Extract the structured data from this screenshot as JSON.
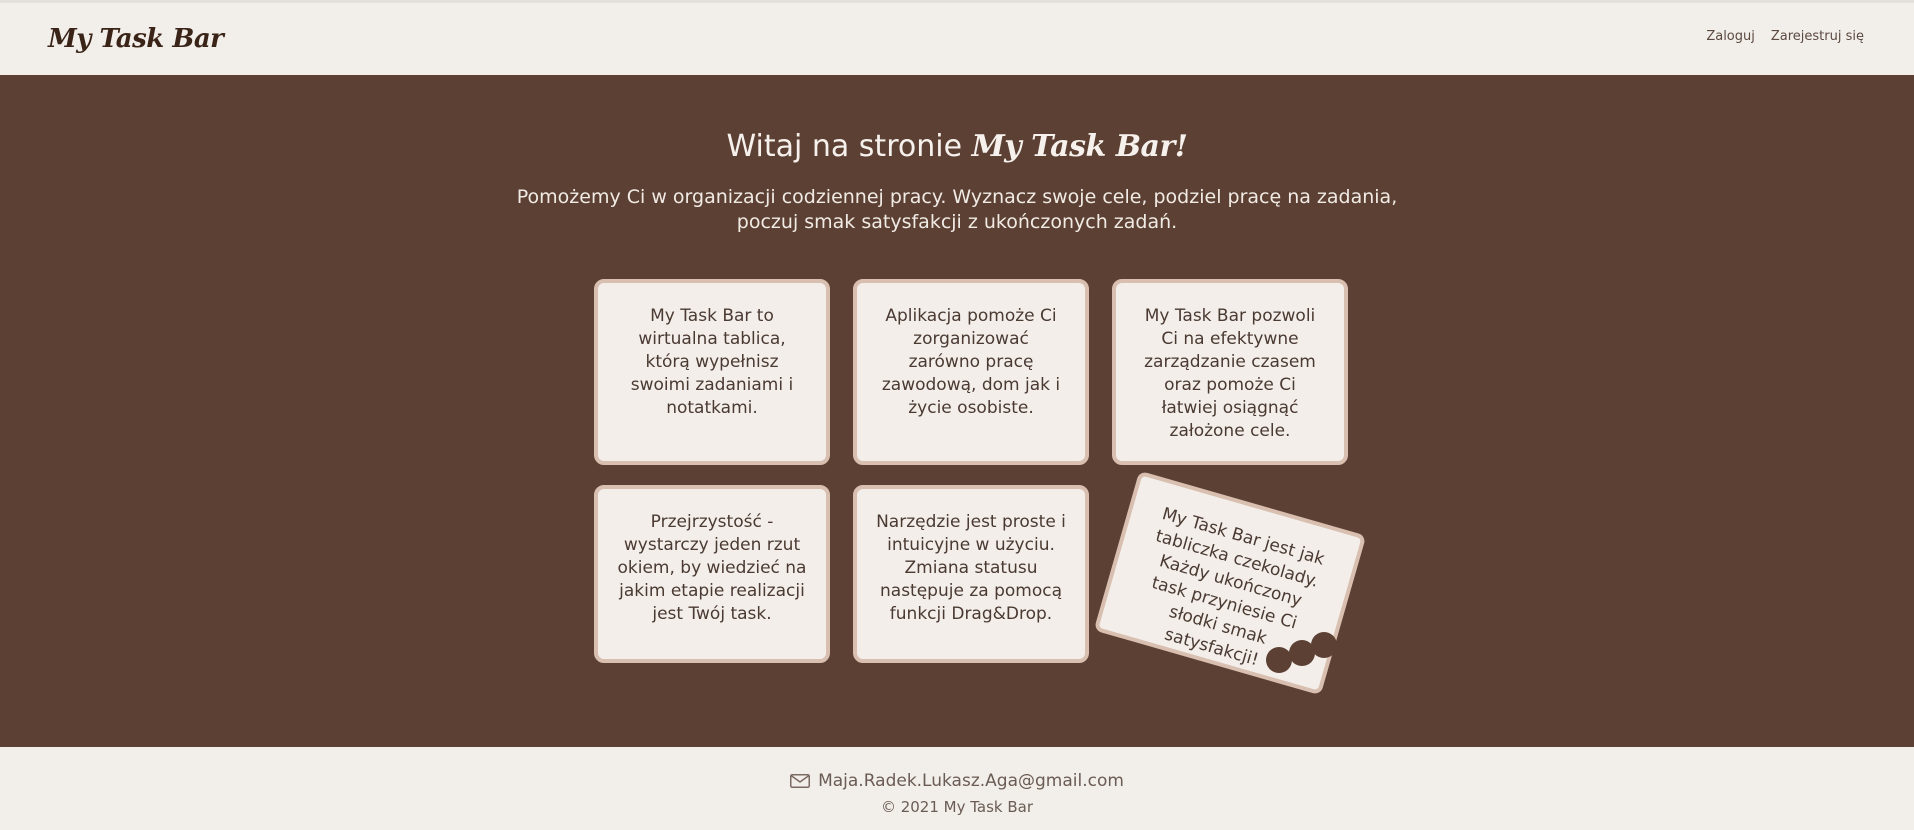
{
  "header": {
    "logo": "My Task Bar",
    "nav": {
      "login": "Zaloguj",
      "register": "Zarejestruj się"
    }
  },
  "hero": {
    "title_prefix": "Witaj na stronie",
    "title_brand": "My Task Bar!",
    "subtitle_line1": "Pomożemy Ci w organizacji codziennej pracy. Wyznacz swoje cele, podziel pracę na zadania,",
    "subtitle_line2": "poczuj smak satysfakcji z ukończonych zadań."
  },
  "cards": [
    "My Task Bar to wirtualna tablica, którą wypełnisz swoimi zadaniami i notatkami.",
    "Aplikacja pomoże Ci zorganizować zarówno pracę zawodową, dom jak i życie osobiste.",
    "My Task Bar pozwoli Ci na efektywne zarządzanie czasem oraz pomoże Ci łatwiej osiągnąć założone cele.",
    "Przejrzystość - wystarczy jeden rzut okiem, by wiedzieć na jakim etapie realizacji jest Twój task.",
    "Narzędzie jest proste i intuicyjne w użyciu. Zmiana statusu następuje za pomocą funkcji Drag&Drop.",
    "My Task Bar jest jak tabliczka czekolady. Każdy ukończony task przyniesie Ci słodki smak satysfakcji!"
  ],
  "footer": {
    "email": "Maja.Radek.Lukasz.Aga@gmail.com",
    "email_icon": "envelope-icon",
    "copyright": "© 2021 My Task Bar"
  },
  "colors": {
    "main_bg": "#5c4033",
    "header_bg": "#f2eeea",
    "card_bg": "#f3eeea",
    "card_border": "#d9bfb0"
  }
}
